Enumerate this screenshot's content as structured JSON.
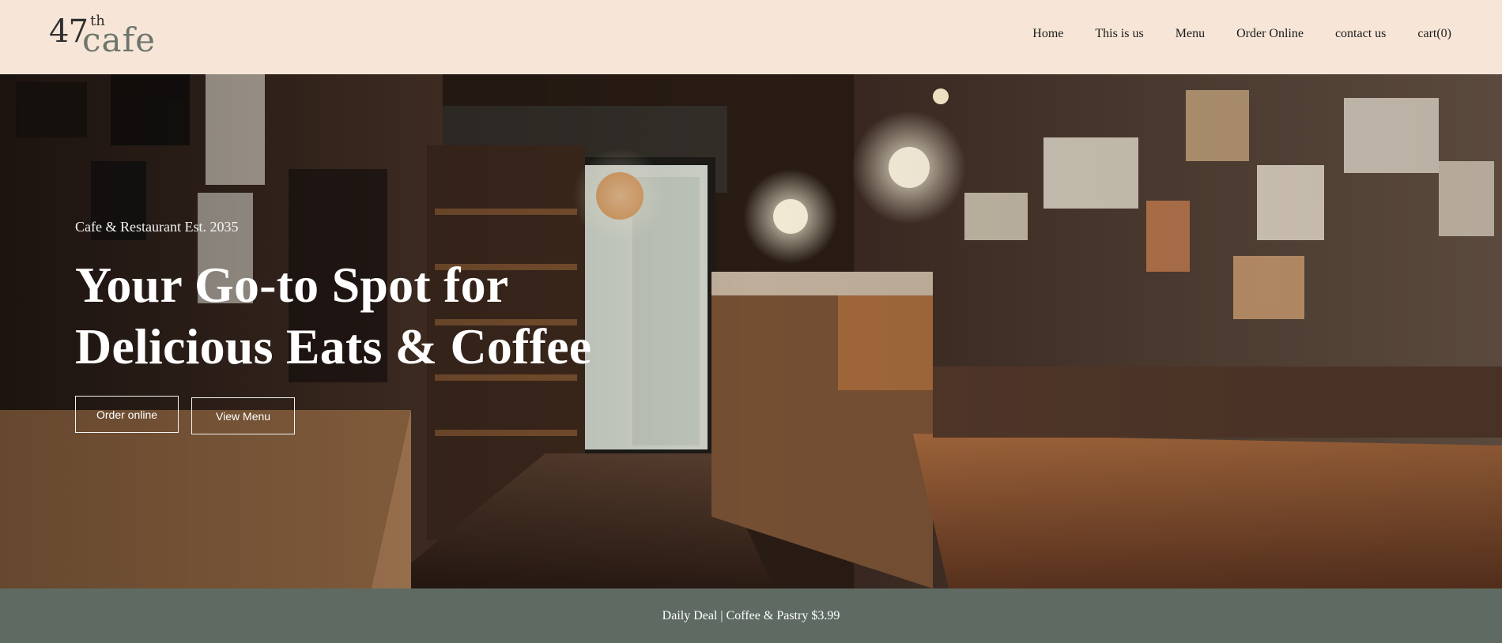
{
  "brand": {
    "logo_number": "47",
    "logo_superscript": "th",
    "logo_word": "cafe"
  },
  "nav": {
    "items": [
      {
        "label": "Home"
      },
      {
        "label": "This is us"
      },
      {
        "label": "Menu"
      },
      {
        "label": "Order Online"
      },
      {
        "label": "contact us"
      },
      {
        "label": "cart(0)"
      }
    ]
  },
  "hero": {
    "eyebrow": "Cafe & Restaurant Est. 2035",
    "headline_line1": "Your Go-to Spot for",
    "headline_line2": "Delicious Eats & Coffee",
    "primary_button": "Order online",
    "secondary_button": "View Menu"
  },
  "deal_bar": {
    "text": "Daily Deal | Coffee & Pastry $3.99"
  },
  "colors": {
    "header_bg": "#f7e6d7",
    "deal_bg": "#5f6b62",
    "hero_text": "#ffffff"
  }
}
